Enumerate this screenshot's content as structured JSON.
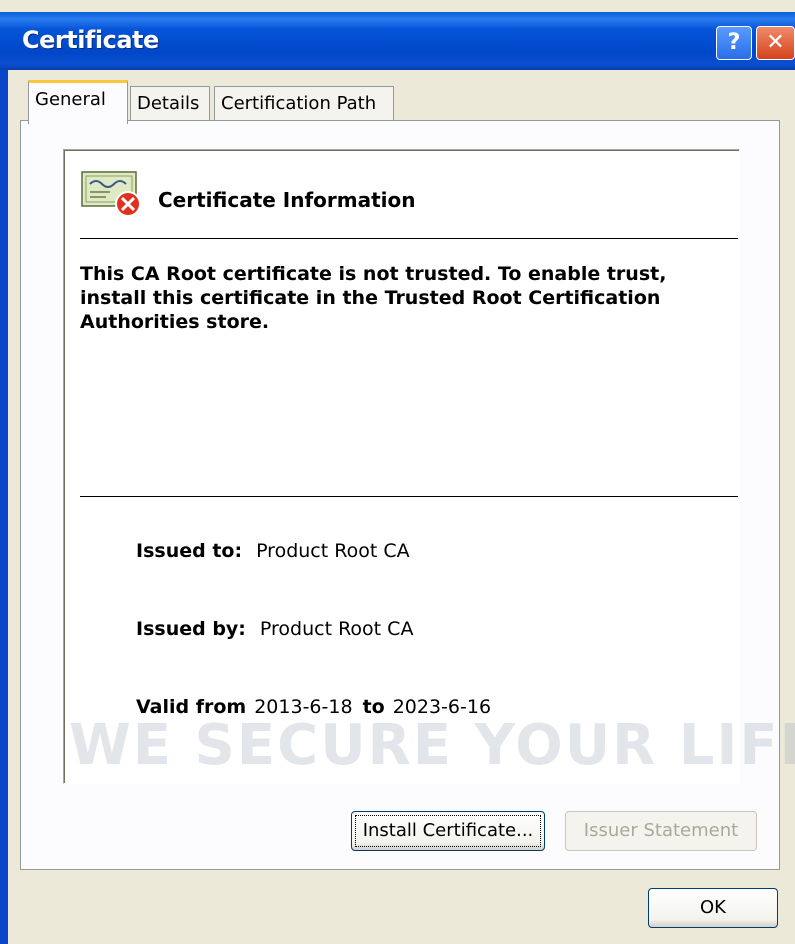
{
  "window": {
    "title": "Certificate",
    "help_glyph": "?",
    "close_glyph": "✕"
  },
  "tabs": [
    {
      "label": "General",
      "active": true
    },
    {
      "label": "Details",
      "active": false
    },
    {
      "label": "Certification Path",
      "active": false
    }
  ],
  "general": {
    "info_title": "Certificate Information",
    "message": "This CA Root certificate is not trusted. To enable trust, install this certificate in the Trusted Root Certification Authorities store.",
    "issued_to_label": "Issued to:",
    "issued_to_value": "Product Root CA",
    "issued_by_label": "Issued by:",
    "issued_by_value": "Product Root CA",
    "valid_from_label": "Valid from",
    "valid_from_value": "2013-6-18",
    "valid_to_label": "to",
    "valid_to_value": "2023-6-16"
  },
  "buttons": {
    "install": "Install Certificate...",
    "issuer_statement": "Issuer Statement",
    "ok": "OK"
  },
  "watermark": "WE SECURE YOUR LIFE",
  "colors": {
    "titlebar": "#0047c8",
    "active_tab_accent": "#ffc83c",
    "error_red": "#e0301e"
  }
}
